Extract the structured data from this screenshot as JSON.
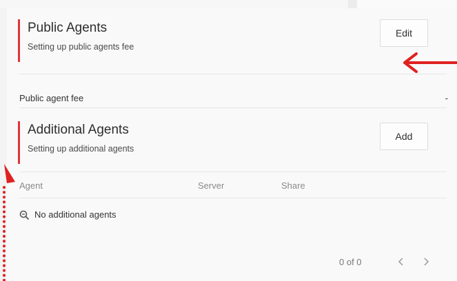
{
  "public_agents": {
    "title": "Public Agents",
    "subtitle": "Setting up public agents fee",
    "edit_label": "Edit",
    "fee_label": "Public agent fee",
    "fee_value": "-"
  },
  "additional_agents": {
    "title": "Additional Agents",
    "subtitle": "Setting up additional agents",
    "add_label": "Add",
    "columns": [
      "Agent",
      "Server",
      "Share"
    ],
    "empty_text": "No additional agents",
    "pagination": "0 of 0"
  },
  "icons": {
    "empty": "search-icon",
    "prev": "chevron-left-icon",
    "next": "chevron-right-icon"
  },
  "colors": {
    "accent": "#e0343a",
    "annotation": "#e02020"
  }
}
